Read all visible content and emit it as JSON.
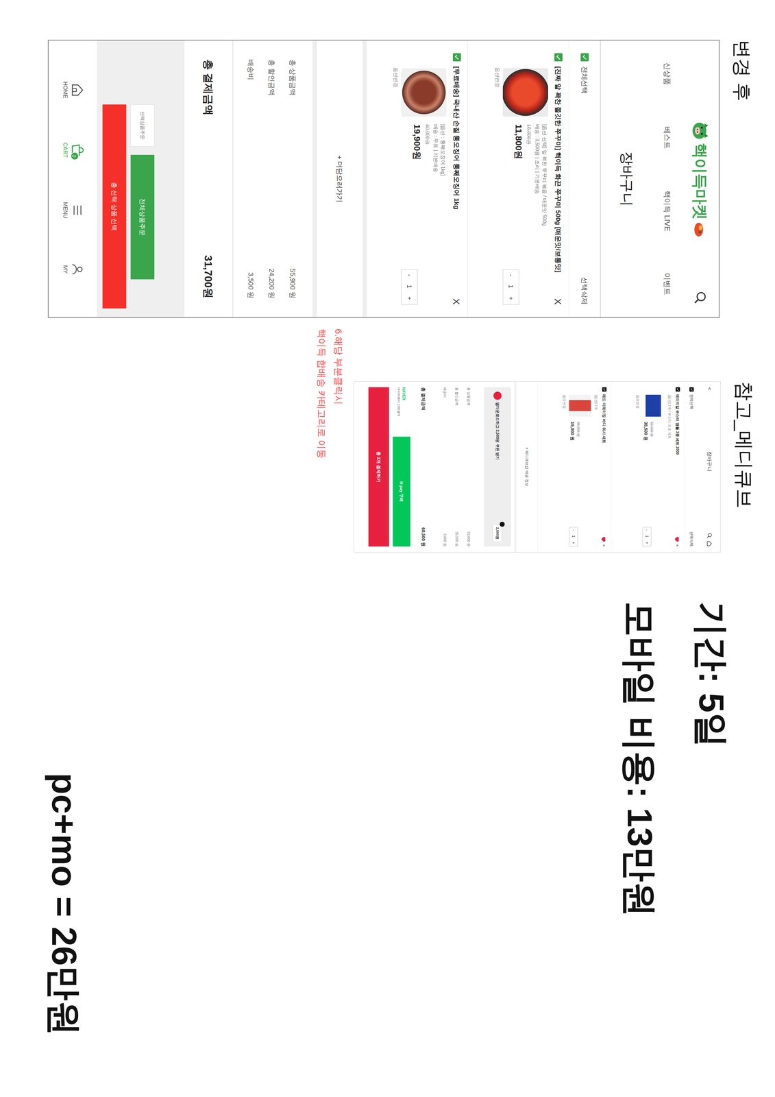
{
  "after": {
    "title": "변경 후",
    "logo": "핵이득마켓",
    "nav": [
      "신상품",
      "베스트",
      "핵이득 LIVE",
      "이벤트"
    ],
    "page_title": "장바구니",
    "select_all": {
      "label": "전체선택",
      "checked": true
    },
    "delete_selected": "선택삭제",
    "items": [
      {
        "checked": true,
        "title": "[진짜 알 꽉찬 쫄깃한 쭈꾸미] 핵이득 화끈 쭈꾸미 500g [매운맛/보통맛]",
        "details": [
          "[옵션 선택] 알 꽉찬 쭈꾸미 볶음 / 매운맛 500g",
          "배송 : 3,500원 | 조리 | 기본배송"
        ],
        "original_price": "16,000원",
        "price": "11,800원",
        "quantity": "1",
        "change": "옵션변경",
        "remove": "X"
      },
      {
        "checked": true,
        "title": "[무료배송] 국내산 손질 통오징어 통째오징어 1kg",
        "details": [
          "[옵션 : 통째오징어 1kg]",
          "배송 : 무료 | 기본배송"
        ],
        "original_price": "40,000원",
        "price": "19,900원",
        "quantity": "1",
        "change": "옵션변경",
        "remove": "X"
      }
    ],
    "stepper": {
      "minus": "-",
      "plus": "+"
    },
    "add_more": "+ 더담으러가기",
    "summary": [
      {
        "label": "총 상품금액",
        "value": "55,900 원"
      },
      {
        "label": "총 할인금액",
        "value": "24,200 원"
      },
      {
        "label": "배송비",
        "value": "3,500 원"
      }
    ],
    "total": {
      "label": "총 결제금액",
      "value": "31,700원"
    },
    "order_selected": "선택상품주문",
    "order_all": "전체상품주문",
    "gift": "총 선택 상품 선택",
    "tabs": [
      {
        "label": "HOME",
        "selected": false
      },
      {
        "label": "CART",
        "selected": true,
        "badge": "2"
      },
      {
        "label": "MENU",
        "selected": false
      },
      {
        "label": "MY",
        "selected": false
      }
    ]
  },
  "reference": {
    "title": "참고_메디큐브",
    "back": "<",
    "page_title": "장바구니",
    "select_all": {
      "label": "전체선택",
      "checked": true
    },
    "delete_selected": "선택삭제",
    "items": [
      {
        "checked": true,
        "title": "에이지알 부스터 앰플 3종 세트 2000",
        "detail": "[옵션] 1개 / 부스터 프로 세트",
        "original_price": "55,000 원",
        "price": "38,500 원",
        "quantity": "1",
        "wished": true,
        "remove": "×",
        "change": "옵션변경"
      },
      {
        "checked": true,
        "title": "레드 이레이징 바디 워시 세트",
        "detail": "[옵션] 1개",
        "original_price": "38,000 원",
        "price": "19,000 원",
        "quantity": "1",
        "wished": true,
        "remove": "×",
        "change": "옵션변경"
      }
    ],
    "stepper": {
      "minus": "-",
      "plus": "+"
    },
    "add_more": "+ 메디큐브샵 배송 정보",
    "coupon": {
      "text": "앱다운로드하고 2,500원 쿠폰 받기",
      "badge": "2,500원"
    },
    "summary": [
      {
        "label": "총 상품금액",
        "value": "93,000 원"
      },
      {
        "label": "총 할인금액",
        "value": "35,500 원"
      },
      {
        "label": "배송비",
        "value": "3,000 원"
      }
    ],
    "total": {
      "label": "총 결제금액",
      "value": "60,500 원"
    },
    "npay": {
      "brand": "NAVER",
      "note": "네이버페이 간편결제",
      "button": "N pay 구매"
    },
    "order": "총 2개 결제하기"
  },
  "annotation": {
    "lines": [
      "6.해당 부분클릭시",
      "핵이득 합배송 카테고리로 이동"
    ]
  },
  "info": {
    "period": "기간: 5일",
    "mobile_cost": "모바일 비용: 13만원",
    "total": "pc+mo = 26만원"
  }
}
